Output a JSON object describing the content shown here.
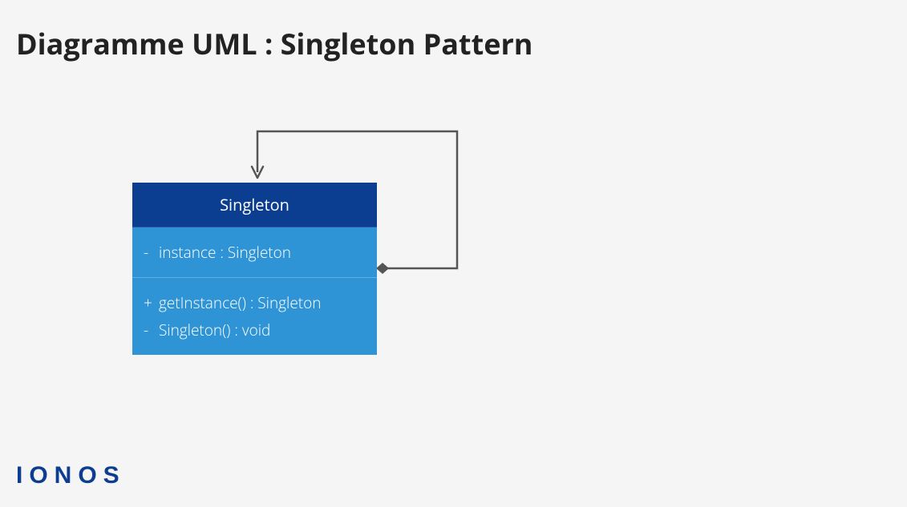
{
  "title": "Diagramme UML : Singleton Pattern",
  "logo": "IONOS",
  "uml": {
    "className": "Singleton",
    "attributes": [
      {
        "visibility": "-",
        "text": "instance : Singleton"
      }
    ],
    "operations": [
      {
        "visibility": "+",
        "text": "getInstance() : Singleton"
      },
      {
        "visibility": "-",
        "text": "Singleton() : void"
      }
    ]
  },
  "colors": {
    "headerBg": "#0b3d91",
    "bodyBg": "#2f94d6",
    "pageBg": "#f5f5f5",
    "connector": "#555555"
  }
}
